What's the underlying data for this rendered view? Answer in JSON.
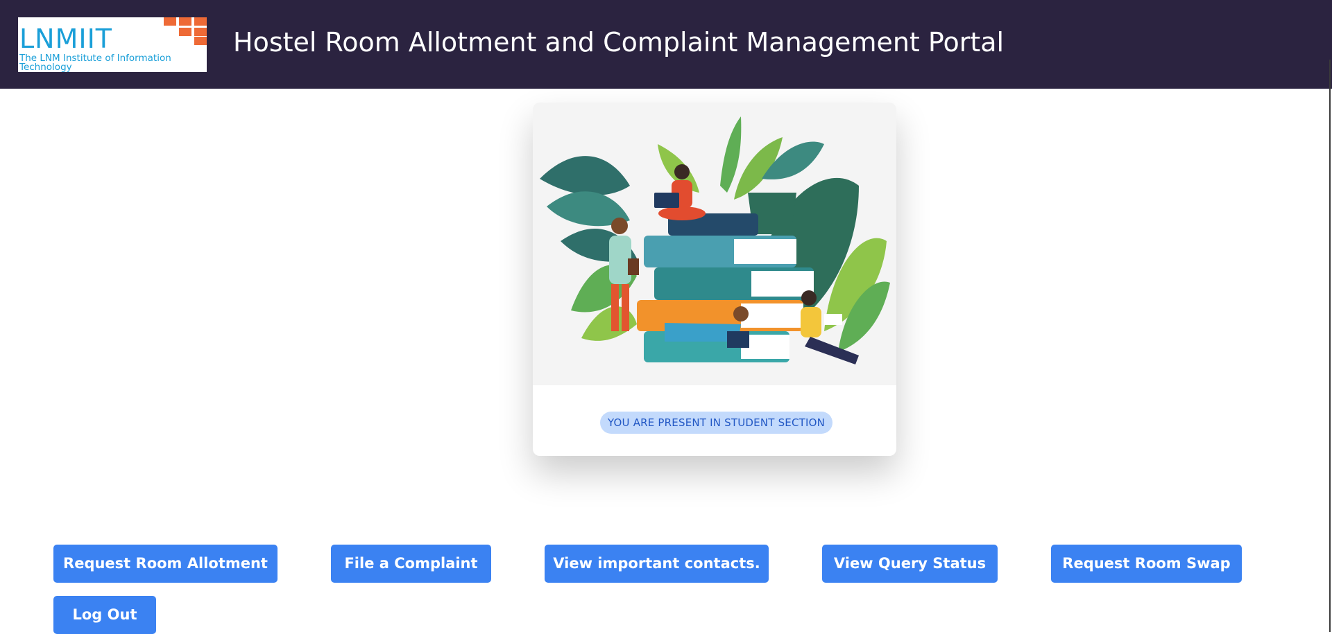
{
  "header": {
    "logo": {
      "name": "LNMIIT",
      "subtitle": "The LNM Institute of Information Technology"
    },
    "title": "Hostel Room Allotment and Complaint Management Portal"
  },
  "card": {
    "illustration_icon": "students-reading-books-illustration",
    "badge": "YOU ARE PRESENT IN STUDENT SECTION"
  },
  "actions": {
    "request_room_allotment": "Request Room Allotment",
    "file_complaint": "File a Complaint",
    "view_contacts": "View important contacts.",
    "view_query_status": "View Query Status",
    "request_room_swap": "Request Room Swap",
    "log_out": "Log Out"
  },
  "colors": {
    "header_bg": "#2b2340",
    "button_bg": "#3b82f2",
    "badge_bg": "#c3dafc",
    "badge_text": "#2157c4",
    "logo_blue": "#1a9fd8",
    "logo_orange": "#ee6a36"
  }
}
